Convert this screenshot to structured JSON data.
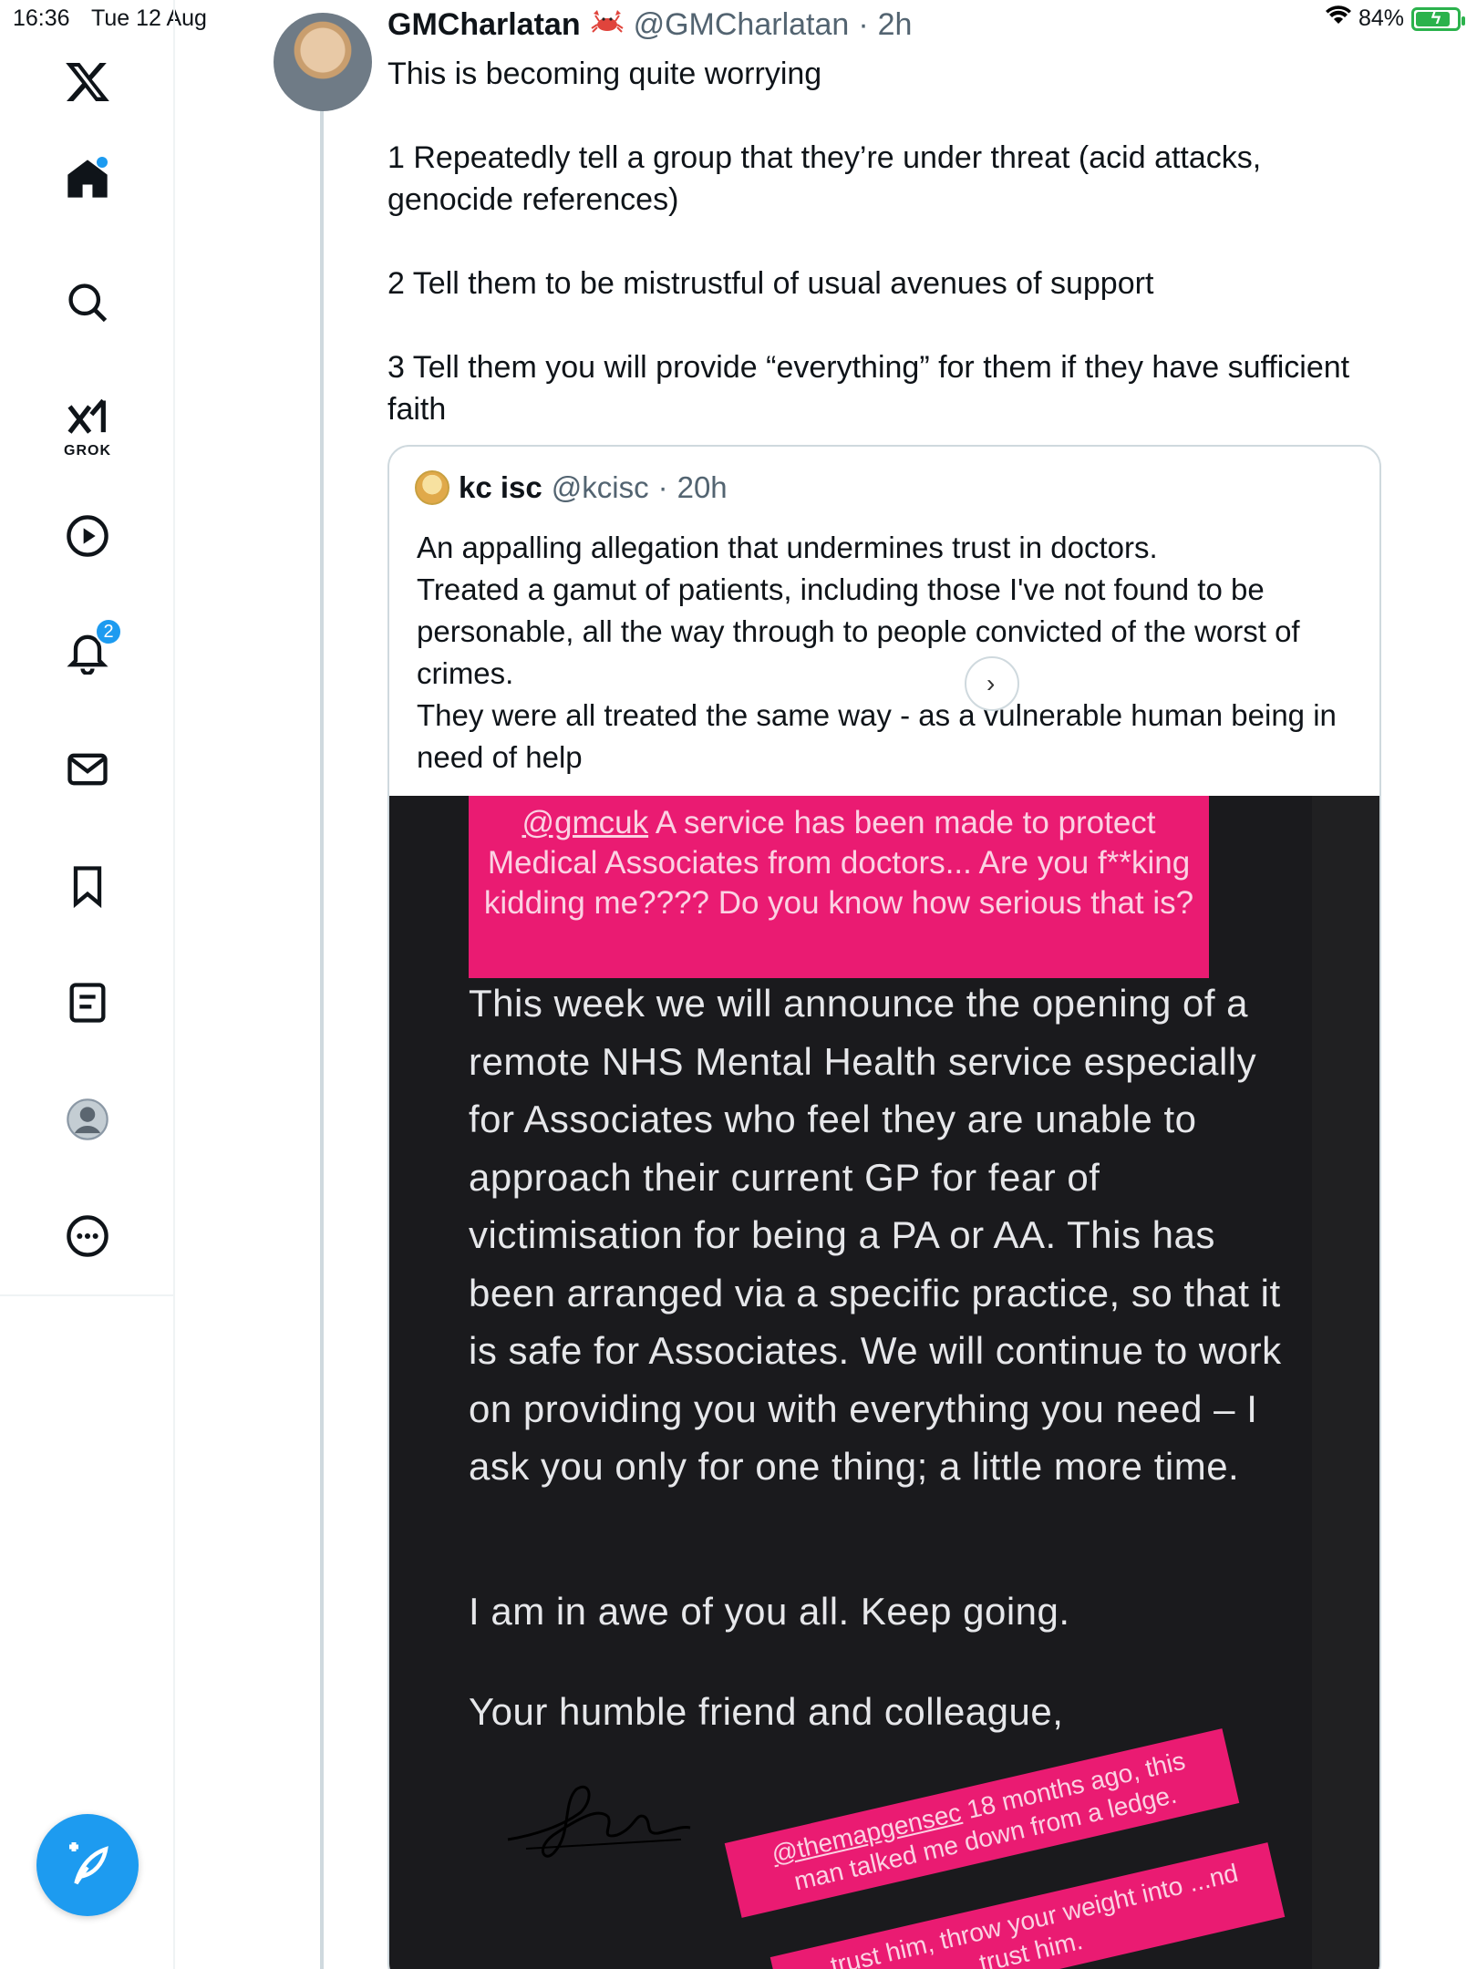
{
  "status_bar": {
    "time": "16:36",
    "date": "Tue 12 Aug",
    "battery": "84%",
    "battery_level": 0.84
  },
  "sidebar": {
    "grok_label": "GROK",
    "notifications_badge": "2"
  },
  "tweet": {
    "author_name": "GMCharlatan",
    "handle": "@GMCharlatan",
    "separator": "·",
    "time": "2h",
    "text": "This is becoming quite worrying\n\n1 Repeatedly tell a group that they’re under threat (acid attacks, genocide references)\n\n2 Tell them to be mistrustful of usual avenues of support\n\n3 Tell them you will provide “everything” for them if they have sufficient faith"
  },
  "quote": {
    "author_name": "kc isc",
    "handle": "@kcisc",
    "separator": "·",
    "time": "20h",
    "text": "An appalling allegation that undermines trust in doctors.\nTreated a gamut of patients, including those I've not found to be personable, all the way through to people convicted of the worst of crimes.\nThey were all treated the same way - as a vulnerable human being in need of help"
  },
  "media": {
    "pink_mention": "@gmcuk",
    "pink_text": " A service has been made to protect Medical Associates from doctors... Are you f**king kidding me???? Do you know how serious that is?",
    "story_text": "This week we will announce the opening of a remote NHS Mental Health service especially for Associates who feel they are unable to approach their current GP for fear of victimisation for being a PA or AA. This has been arranged via a specific practice, so that it is safe for Associates. We will continue to work on providing you with everything you need – I ask you only for one thing; a little more time.",
    "story_p2": "I am in awe of you all. Keep going.",
    "story_p3": "Your humble friend and colleague,",
    "sticker1_mention": "@themapgensec",
    "sticker1_text": " 18 months ago, this man talked me down from a ledge.",
    "sticker2_text": "...trust him, throw your weight into ...nd trust him."
  }
}
